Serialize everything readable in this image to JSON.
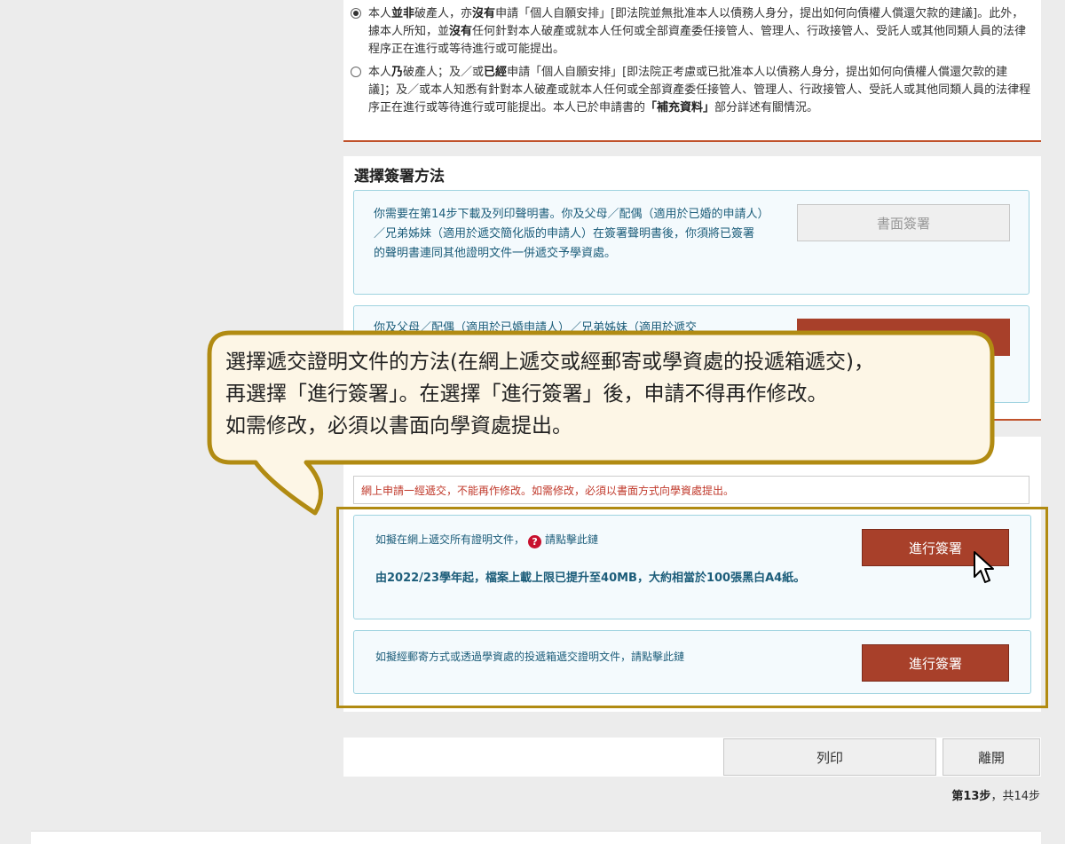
{
  "declaration": {
    "option1": {
      "selected": true,
      "p1": "本人",
      "b1": "並非",
      "p2": "破產人，亦",
      "b2": "沒有",
      "p3": "申請「個人自願安排」[即法院並無批准本人以債務人身分，提出如何向債權人償還欠款的建議]。此外，據本人所知，並",
      "b3": "沒有",
      "p4": "任何針對本人破產或就本人任何或全部資產委任接管人、管理人、行政接管人、受託人或其他同類人員的法律程序正在進行或等待進行或可能提出。"
    },
    "option2": {
      "selected": false,
      "p1": "本人",
      "b1": "乃",
      "p2": "破產人；及／或",
      "b2": "已經",
      "p3": "申請「個人自願安排」[即法院正考慮或已批准本人以債務人身分，提出如何向債權人償還欠款的建議]；及／或本人知悉有針對本人破產或就本人任何或全部資產委任接管人、管理人、行政接管人、受託人或其他同類人員的法律程序正在進行或等待進行或可能提出。本人已於申請書的",
      "b3": "「補充資料」",
      "p4": "部分詳述有關情況。"
    }
  },
  "signing": {
    "title": "選擇簽署方法",
    "paper_text": "你需要在第14步下載及列印聲明書。你及父母／配偶（適用於已婚的申請人）／兄弟姊妹（適用於遞交簡化版的申請人）在簽署聲明書後，你須將已簽署的聲明書連同其他證明文件一併遞交予學資處。",
    "paper_button": "書面簽署",
    "online_text_partial": "你及父母／配偶（適用於已婚申請人）／兄弟姊妹（適用於遞交"
  },
  "callout": {
    "line1": "選擇遞交證明文件的方法(在網上遞交或經郵寄或學資處的投遞箱遞交)，",
    "line2": "再選擇「進行簽署」。在選擇「進行簽署」後，申請不得再作修改。",
    "line3": "如需修改，必須以書面向學資處提出。"
  },
  "submission": {
    "warning": "網上申請一經遞交，不能再作修改。如需修改，必須以書面方式向學資處提出。",
    "online_text_a": "如擬在網上遞交所有證明文件，",
    "online_text_b": "請點擊此鏈",
    "help_glyph": "?",
    "online_note": "由2022/23學年起，檔案上載上限已提升至40MB，大約相當於100張黑白A4紙。",
    "online_button": "進行簽署",
    "post_text": "如擬經郵寄方式或透過學資處的投遞箱遞交證明文件，請點擊此鏈",
    "post_button": "進行簽署"
  },
  "footer_actions": {
    "print": "列印",
    "exit": "離開"
  },
  "progress": {
    "current": "第13步",
    "sep": "，",
    "total": "共14步"
  },
  "colors": {
    "accent_red": "#a8402a",
    "highlight_gold": "#b18b12",
    "info_blue": "#1c5d7a",
    "warning_red": "#c0392b"
  }
}
